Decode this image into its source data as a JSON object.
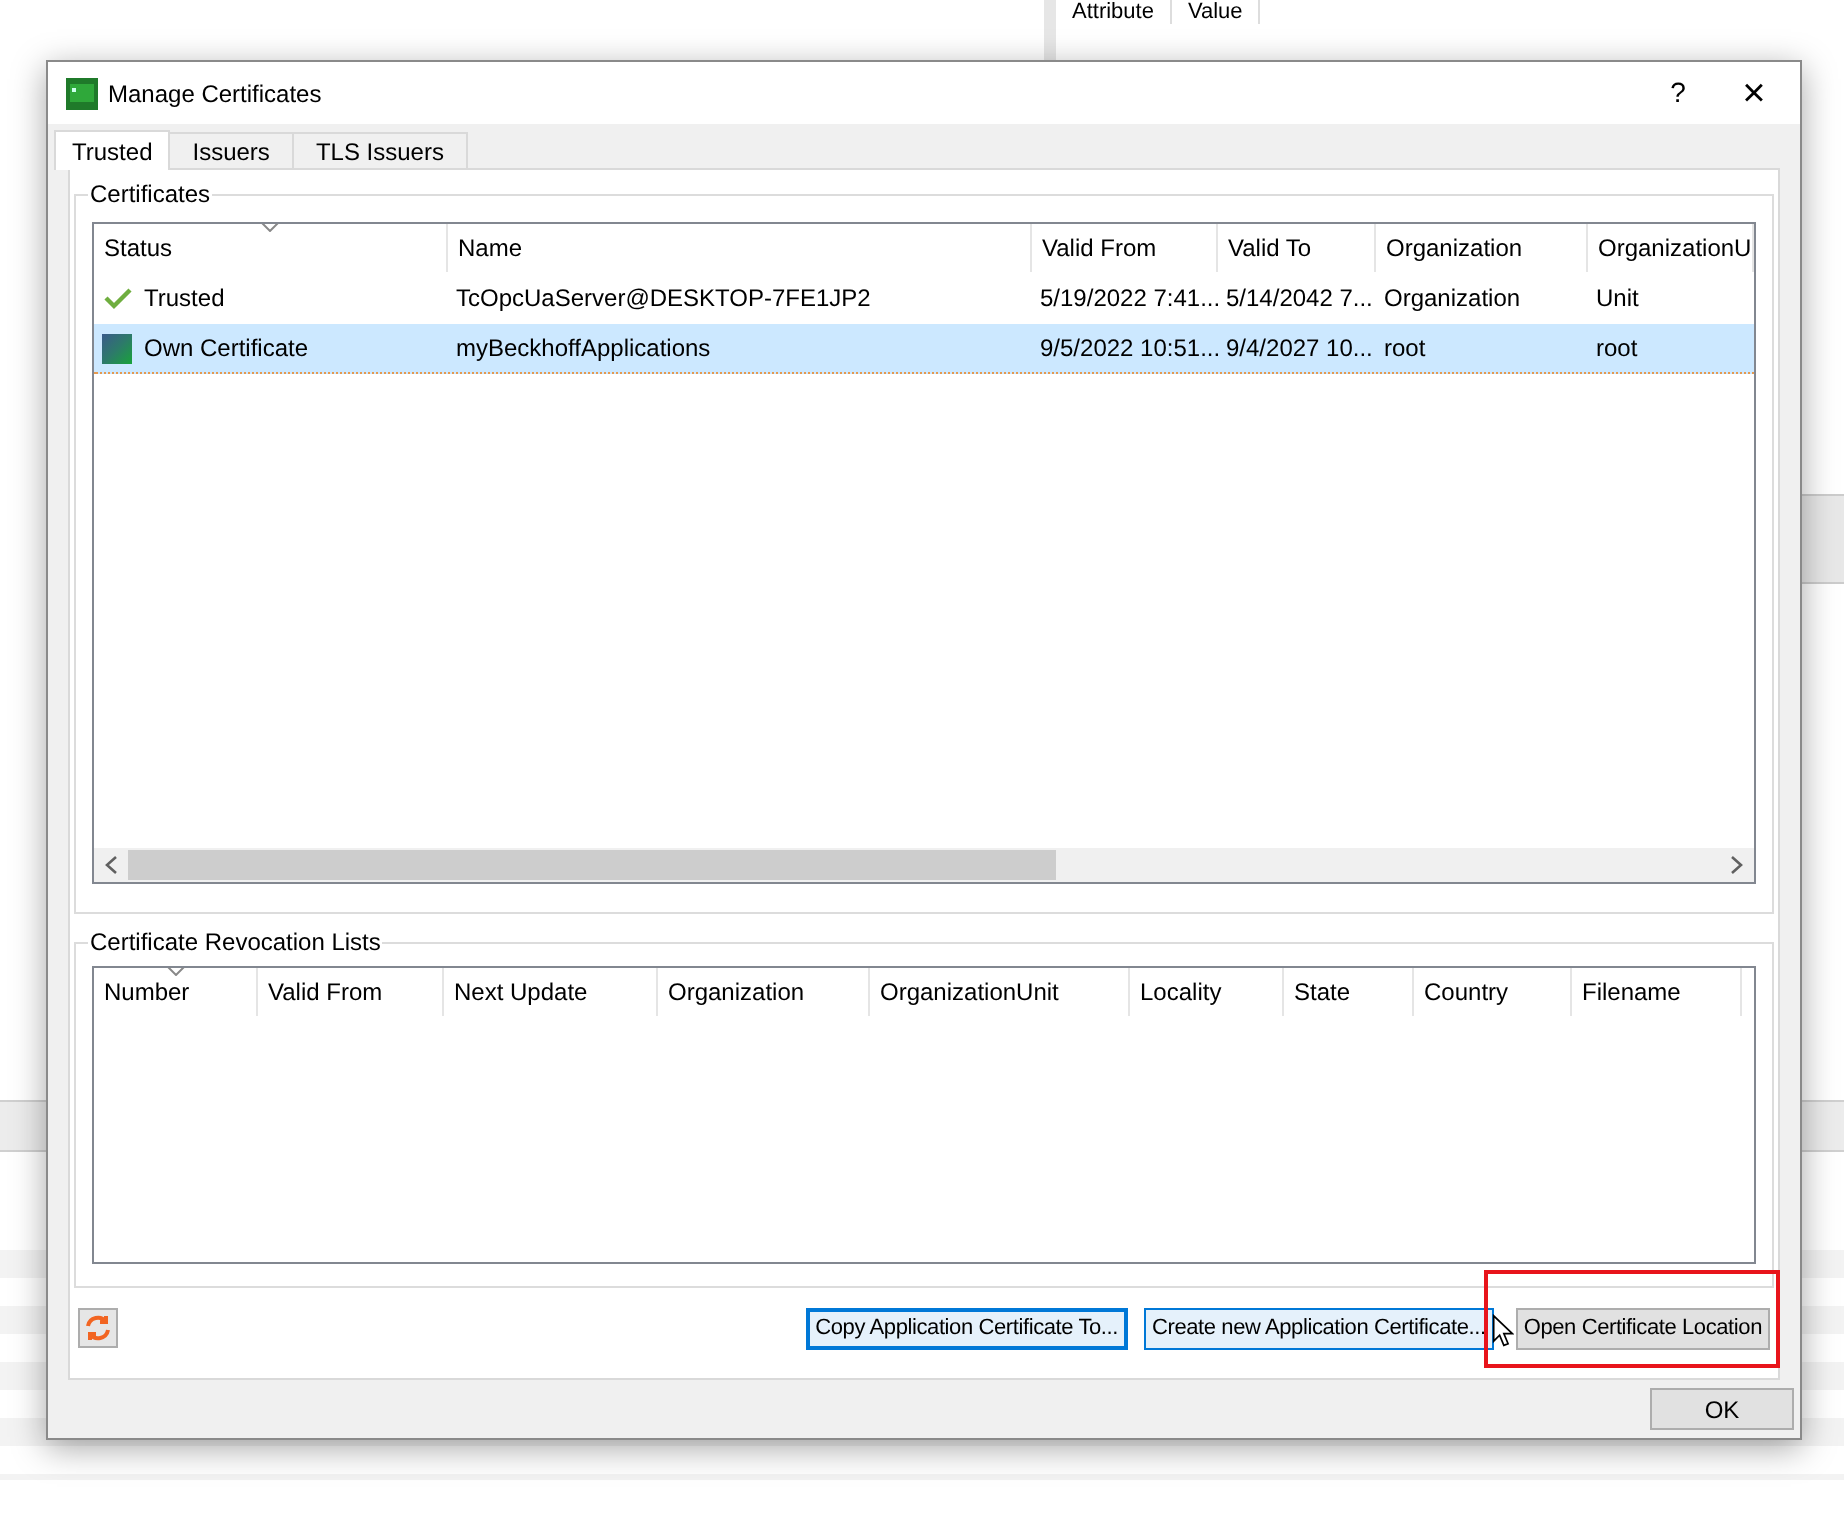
{
  "background_panel": {
    "columns": [
      "Attribute",
      "Value"
    ]
  },
  "window": {
    "title": "Manage Certificates",
    "help": "?",
    "close": "×"
  },
  "tabs": [
    {
      "label": "Trusted",
      "selected": true
    },
    {
      "label": "Issuers",
      "selected": false
    },
    {
      "label": "TLS Issuers",
      "selected": false
    }
  ],
  "certificates": {
    "title": "Certificates",
    "columns": [
      {
        "label": "Status",
        "sorted": true
      },
      {
        "label": "Name",
        "sorted": false
      },
      {
        "label": "Valid From",
        "sorted": false
      },
      {
        "label": "Valid To",
        "sorted": false
      },
      {
        "label": "Organization",
        "sorted": false
      },
      {
        "label": "OrganizationU",
        "sorted": false
      }
    ],
    "rows": [
      {
        "kind": "trusted",
        "selected": false,
        "cells": [
          "Trusted",
          "TcOpcUaServer@DESKTOP-7FE1JP2",
          "5/19/2022 7:41...",
          "5/14/2042 7...",
          "Organization",
          "Unit"
        ]
      },
      {
        "kind": "own",
        "selected": true,
        "cells": [
          "Own Certificate",
          "myBeckhoffApplications",
          "9/5/2022 10:51...",
          "9/4/2027 10...",
          "root",
          "root"
        ]
      }
    ]
  },
  "revocation_lists": {
    "title": "Certificate Revocation Lists",
    "columns": [
      {
        "label": "Number",
        "sorted": true
      },
      {
        "label": "Valid From",
        "sorted": false
      },
      {
        "label": "Next Update",
        "sorted": false
      },
      {
        "label": "Organization",
        "sorted": false
      },
      {
        "label": "OrganizationUnit",
        "sorted": false
      },
      {
        "label": "Locality",
        "sorted": false
      },
      {
        "label": "State",
        "sorted": false
      },
      {
        "label": "Country",
        "sorted": false
      },
      {
        "label": "Filename",
        "sorted": false
      }
    ]
  },
  "buttons": [
    {
      "label": "Copy Application Certificate To...",
      "kind": "focused",
      "highlighted": false
    },
    {
      "label": "Create new Application Certificate...",
      "kind": "hovered",
      "highlighted": false
    },
    {
      "label": "Open Certificate Location",
      "kind": "normal",
      "highlighted": true
    }
  ],
  "ok_button": {
    "label": "OK"
  }
}
